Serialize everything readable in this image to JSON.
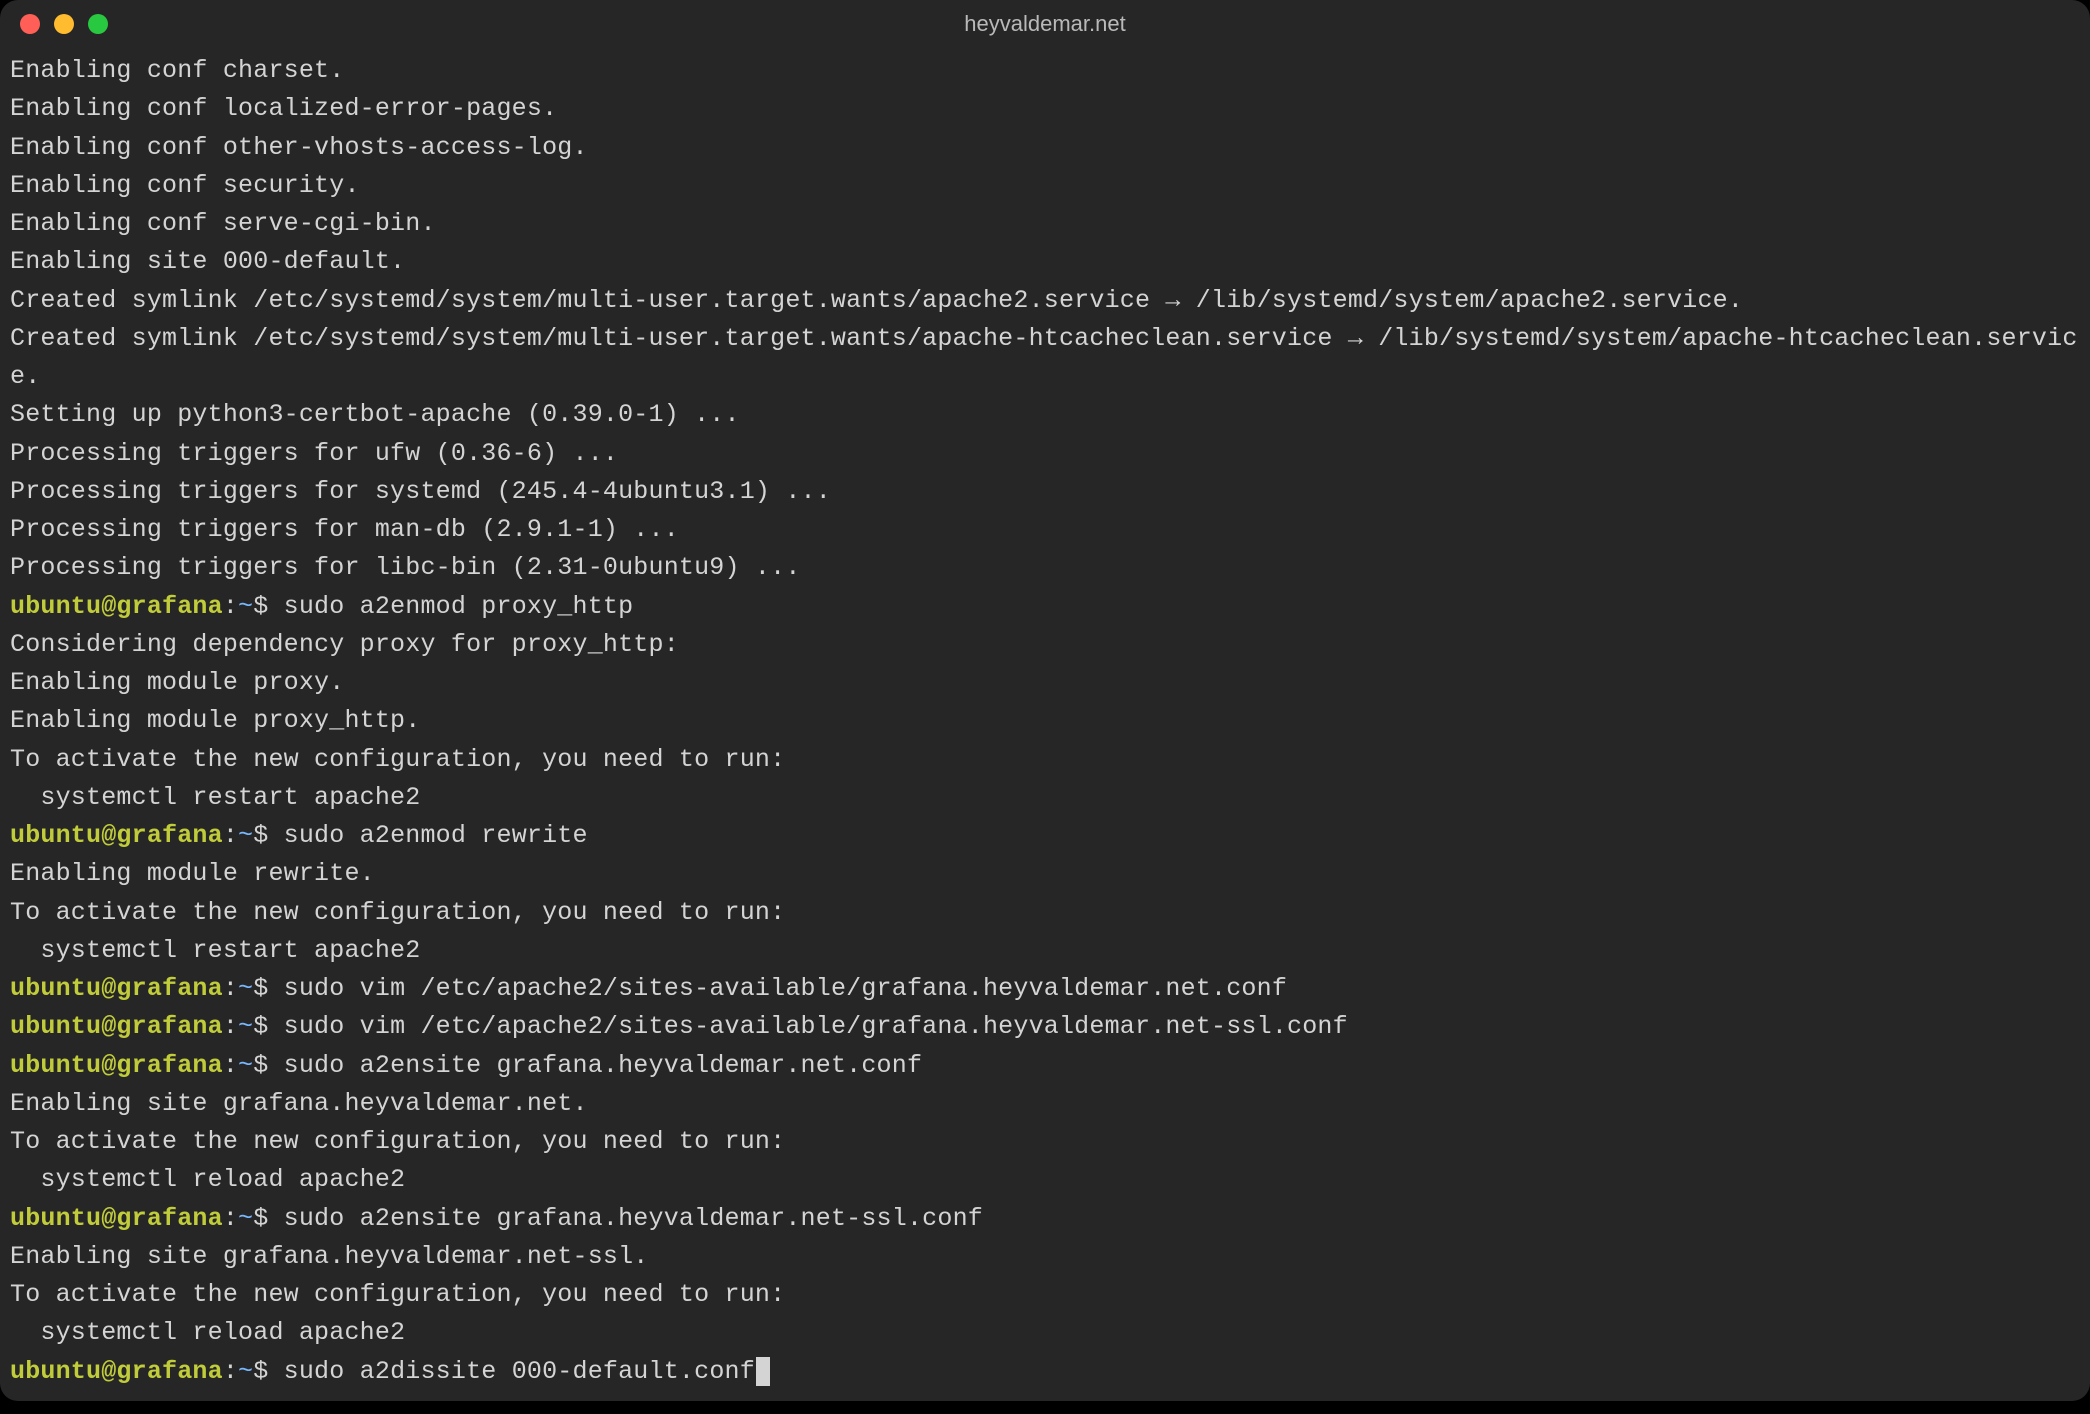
{
  "window": {
    "title": "heyvaldemar.net"
  },
  "prompt": {
    "user": "ubuntu",
    "host": "grafana",
    "path": "~",
    "symbol": "$"
  },
  "colors": {
    "prompt_user_host": "#c1cc3a",
    "prompt_path": "#79b8ff",
    "text": "#d4d4d4",
    "background": "#262626"
  },
  "lines": [
    {
      "type": "out",
      "text": "Enabling conf charset."
    },
    {
      "type": "out",
      "text": "Enabling conf localized-error-pages."
    },
    {
      "type": "out",
      "text": "Enabling conf other-vhosts-access-log."
    },
    {
      "type": "out",
      "text": "Enabling conf security."
    },
    {
      "type": "out",
      "text": "Enabling conf serve-cgi-bin."
    },
    {
      "type": "out",
      "text": "Enabling site 000-default."
    },
    {
      "type": "out",
      "text": "Created symlink /etc/systemd/system/multi-user.target.wants/apache2.service → /lib/systemd/system/apache2.service."
    },
    {
      "type": "out",
      "text": "Created symlink /etc/systemd/system/multi-user.target.wants/apache-htcacheclean.service → /lib/systemd/system/apache-htcacheclean.service."
    },
    {
      "type": "out",
      "text": "Setting up python3-certbot-apache (0.39.0-1) ..."
    },
    {
      "type": "out",
      "text": "Processing triggers for ufw (0.36-6) ..."
    },
    {
      "type": "out",
      "text": "Processing triggers for systemd (245.4-4ubuntu3.1) ..."
    },
    {
      "type": "out",
      "text": "Processing triggers for man-db (2.9.1-1) ..."
    },
    {
      "type": "out",
      "text": "Processing triggers for libc-bin (2.31-0ubuntu9) ..."
    },
    {
      "type": "cmd",
      "text": "sudo a2enmod proxy_http"
    },
    {
      "type": "out",
      "text": "Considering dependency proxy for proxy_http:"
    },
    {
      "type": "out",
      "text": "Enabling module proxy."
    },
    {
      "type": "out",
      "text": "Enabling module proxy_http."
    },
    {
      "type": "out",
      "text": "To activate the new configuration, you need to run:"
    },
    {
      "type": "out",
      "text": "  systemctl restart apache2"
    },
    {
      "type": "cmd",
      "text": "sudo a2enmod rewrite"
    },
    {
      "type": "out",
      "text": "Enabling module rewrite."
    },
    {
      "type": "out",
      "text": "To activate the new configuration, you need to run:"
    },
    {
      "type": "out",
      "text": "  systemctl restart apache2"
    },
    {
      "type": "cmd",
      "text": "sudo vim /etc/apache2/sites-available/grafana.heyvaldemar.net.conf"
    },
    {
      "type": "cmd",
      "text": "sudo vim /etc/apache2/sites-available/grafana.heyvaldemar.net-ssl.conf"
    },
    {
      "type": "cmd",
      "text": "sudo a2ensite grafana.heyvaldemar.net.conf"
    },
    {
      "type": "out",
      "text": "Enabling site grafana.heyvaldemar.net."
    },
    {
      "type": "out",
      "text": "To activate the new configuration, you need to run:"
    },
    {
      "type": "out",
      "text": "  systemctl reload apache2"
    },
    {
      "type": "cmd",
      "text": "sudo a2ensite grafana.heyvaldemar.net-ssl.conf"
    },
    {
      "type": "out",
      "text": "Enabling site grafana.heyvaldemar.net-ssl."
    },
    {
      "type": "out",
      "text": "To activate the new configuration, you need to run:"
    },
    {
      "type": "out",
      "text": "  systemctl reload apache2"
    },
    {
      "type": "cmd",
      "text": "sudo a2dissite 000-default.conf",
      "cursor": true
    }
  ]
}
